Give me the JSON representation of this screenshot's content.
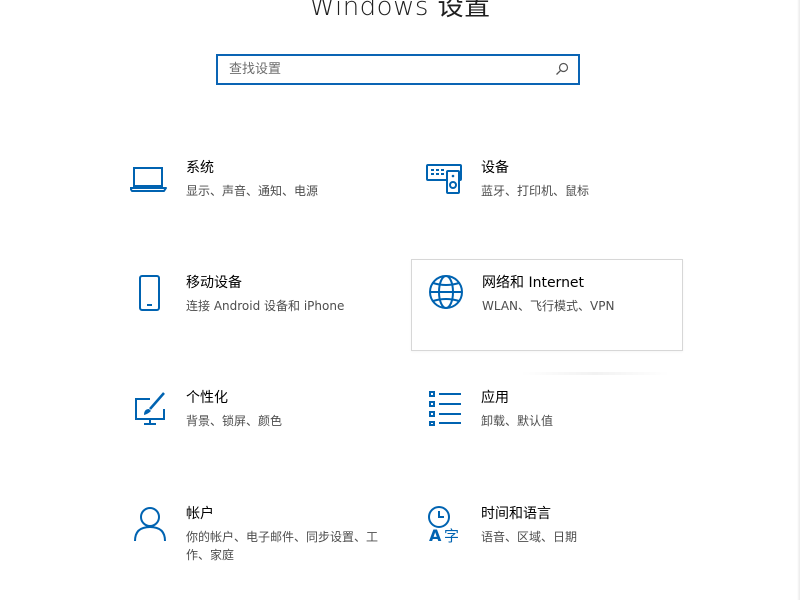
{
  "window": {
    "title": "Windows 设置"
  },
  "search": {
    "placeholder": "查找设置",
    "value": ""
  },
  "colors": {
    "accent": "#0a64b4",
    "icon": "#0063b1",
    "text_primary": "#000000",
    "text_secondary": "#4d4d4d"
  },
  "tiles": [
    {
      "title": "系统",
      "desc": "显示、声音、通知、电源",
      "icon": "laptop-icon"
    },
    {
      "title": "设备",
      "desc": "蓝牙、打印机、鼠标",
      "icon": "keyboard-speaker-icon"
    },
    {
      "title": "移动设备",
      "desc": "连接 Android 设备和 iPhone",
      "icon": "phone-icon"
    },
    {
      "title": "网络和 Internet",
      "desc": "WLAN、飞行模式、VPN",
      "icon": "globe-icon"
    },
    {
      "title": "个性化",
      "desc": "背景、锁屏、颜色",
      "icon": "paint-monitor-icon"
    },
    {
      "title": "应用",
      "desc": "卸载、默认值",
      "icon": "app-list-icon"
    },
    {
      "title": "帐户",
      "desc": "你的帐户、电子邮件、同步设置、工作、家庭",
      "icon": "person-icon"
    },
    {
      "title": "时间和语言",
      "desc": "语音、区域、日期",
      "icon": "time-language-icon"
    }
  ]
}
